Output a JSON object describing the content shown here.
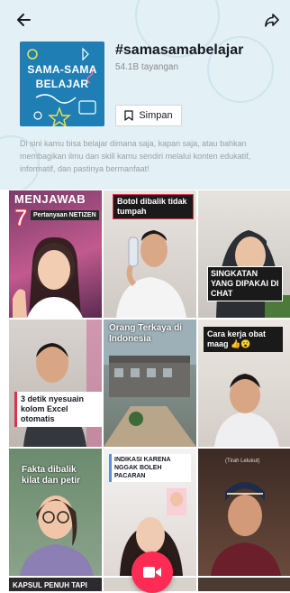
{
  "hashtag": {
    "title": "#samasamabelajar",
    "views": "54.1B tayangan",
    "cover": {
      "line1": "SAMA-SAMA",
      "line2": "BELAJAR"
    },
    "save_label": "Simpan",
    "description": "Di sini kamu bisa belajar dimana saja, kapan saja, atau bahkan membagikan ilmu dan skill kamu sendiri melalui konten edukatif, informatif, dan pastinya bermanfaat!"
  },
  "icons": {
    "back": "arrow-left-icon",
    "share": "share-arrow-icon",
    "bookmark": "bookmark-icon",
    "camera": "video-camera-icon"
  },
  "videos": [
    {
      "caption_a": "MENJAWAB",
      "caption_b": "7",
      "caption_c": "Pertanyaan NETIZEN"
    },
    {
      "caption": "Botol dibalik tidak tumpah"
    },
    {
      "caption": "SINGKATAN YANG DIPAKAI DI CHAT"
    },
    {
      "caption": "3 detik nyesuain kolom Excel otomatis"
    },
    {
      "caption": "Orang Terkaya di Indonesia"
    },
    {
      "caption": "Cara kerja obat maag 👍😮"
    },
    {
      "caption": "Fakta dibalik kilat dan petir"
    },
    {
      "caption": "INDIKASI KARENA NGGAK BOLEH PACARAN"
    },
    {
      "caption": "(Tirah Lelukut)"
    },
    {
      "caption": "KAPSUL PENUH TAPI"
    }
  ],
  "colors": {
    "accent": "#fe2c55",
    "cover_bg": "#1f7fb4",
    "header_bg": "#e3f0f5"
  }
}
